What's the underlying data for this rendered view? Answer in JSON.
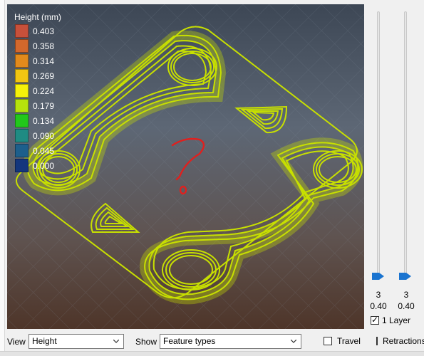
{
  "legend": {
    "title": "Height (mm)",
    "items": [
      {
        "value": "0.403",
        "color": "#c8503a"
      },
      {
        "value": "0.358",
        "color": "#d3682c"
      },
      {
        "value": "0.314",
        "color": "#e28a1c"
      },
      {
        "value": "0.269",
        "color": "#f2c612"
      },
      {
        "value": "0.224",
        "color": "#f5f20a"
      },
      {
        "value": "0.179",
        "color": "#b6e20d"
      },
      {
        "value": "0.134",
        "color": "#22c81b"
      },
      {
        "value": "0.090",
        "color": "#1f8b83"
      },
      {
        "value": "0.045",
        "color": "#1d5f8c"
      },
      {
        "value": "0.000",
        "color": "#14367d"
      }
    ]
  },
  "annotation": {
    "text": "?",
    "color": "#e0201e"
  },
  "colors": {
    "extrusion": "#c8e000",
    "extrusion_dark": "#6d7a00",
    "slider_handle": "#1a74d0"
  },
  "sliders": {
    "left": {
      "layer": "3",
      "height": "0.40"
    },
    "right": {
      "layer": "3",
      "height": "0.40"
    }
  },
  "one_layer": {
    "label": "1 Layer",
    "checked": true
  },
  "bottom": {
    "view_label": "View",
    "view_value": "Height",
    "show_label": "Show",
    "show_value": "Feature types",
    "travel_label": "Travel",
    "travel_checked": false,
    "retraction_label": "Retractions",
    "retraction_checked": false
  }
}
